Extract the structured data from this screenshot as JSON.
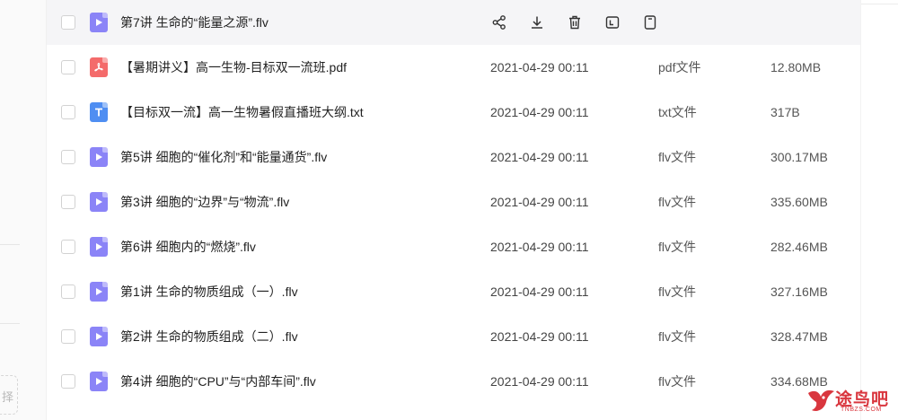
{
  "sidebar": {
    "truncated_label": "择"
  },
  "row_actions": [
    "share-icon",
    "download-icon",
    "delete-icon",
    "rename-icon",
    "more-icon"
  ],
  "files": [
    {
      "name": "第7讲 生命的“能量之源”.flv",
      "kind": "video",
      "date": "",
      "type": "",
      "size": "",
      "hovered": true
    },
    {
      "name": "【暑期讲义】高一生物-目标双一流班.pdf",
      "kind": "pdf",
      "date": "2021-04-29 00:11",
      "type": "pdf文件",
      "size": "12.80MB"
    },
    {
      "name": "【目标双一流】高一生物暑假直播班大纲.txt",
      "kind": "txt",
      "date": "2021-04-29 00:11",
      "type": "txt文件",
      "size": "317B"
    },
    {
      "name": "第5讲 细胞的“催化剂”和“能量通货”.flv",
      "kind": "video",
      "date": "2021-04-29 00:11",
      "type": "flv文件",
      "size": "300.17MB"
    },
    {
      "name": "第3讲 细胞的“边界”与“物流”.flv",
      "kind": "video",
      "date": "2021-04-29 00:11",
      "type": "flv文件",
      "size": "335.60MB"
    },
    {
      "name": "第6讲 细胞内的“燃烧”.flv",
      "kind": "video",
      "date": "2021-04-29 00:11",
      "type": "flv文件",
      "size": "282.46MB"
    },
    {
      "name": "第1讲 生命的物质组成（一）.flv",
      "kind": "video",
      "date": "2021-04-29 00:11",
      "type": "flv文件",
      "size": "327.16MB"
    },
    {
      "name": "第2讲 生命的物质组成（二）.flv",
      "kind": "video",
      "date": "2021-04-29 00:11",
      "type": "flv文件",
      "size": "328.47MB"
    },
    {
      "name": "第4讲 细胞的“CPU”与“内部车间”.flv",
      "kind": "video",
      "date": "2021-04-29 00:11",
      "type": "flv文件",
      "size": "334.68MB"
    }
  ],
  "watermark": {
    "text": "途鸟吧",
    "sub": "TNBZS.COM"
  },
  "colors": {
    "video_icon": "#8b84f7",
    "pdf_icon": "#f46b6b",
    "txt_icon": "#4f8ef2",
    "hover_row": "#f5f5f7",
    "watermark": "#d9363e"
  }
}
